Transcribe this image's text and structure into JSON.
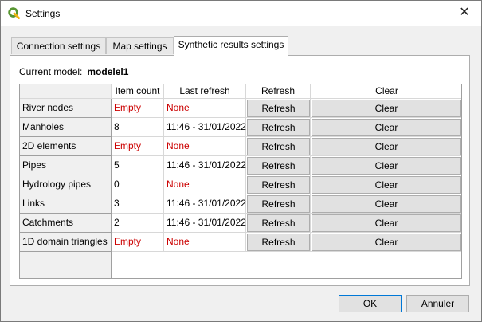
{
  "window": {
    "title": "Settings"
  },
  "tabs": [
    {
      "label": "Connection settings",
      "active": false
    },
    {
      "label": "Map settings",
      "active": false
    },
    {
      "label": "Synthetic results settings",
      "active": true
    }
  ],
  "model": {
    "label": "Current model:",
    "value": "modelel1"
  },
  "table": {
    "headers": [
      "Item count",
      "Last refresh",
      "Refresh",
      "Clear"
    ],
    "rows": [
      {
        "name": "River nodes",
        "count": "Empty",
        "last_refresh": "None",
        "refresh": "Refresh",
        "clear": "Clear",
        "empty": true
      },
      {
        "name": "Manholes",
        "count": "8",
        "last_refresh": "11:46 - 31/01/2022",
        "refresh": "Refresh",
        "clear": "Clear",
        "empty": false
      },
      {
        "name": "2D elements",
        "count": "Empty",
        "last_refresh": "None",
        "refresh": "Refresh",
        "clear": "Clear",
        "empty": true
      },
      {
        "name": "Pipes",
        "count": "5",
        "last_refresh": "11:46 - 31/01/2022",
        "refresh": "Refresh",
        "clear": "Clear",
        "empty": false
      },
      {
        "name": "Hydrology pipes",
        "count": "0",
        "last_refresh": "None",
        "refresh": "Refresh",
        "clear": "Clear",
        "empty": false,
        "last_refresh_red": true
      },
      {
        "name": "Links",
        "count": "3",
        "last_refresh": "11:46 - 31/01/2022",
        "refresh": "Refresh",
        "clear": "Clear",
        "empty": false
      },
      {
        "name": "Catchments",
        "count": "2",
        "last_refresh": "11:46 - 31/01/2022",
        "refresh": "Refresh",
        "clear": "Clear",
        "empty": false
      },
      {
        "name": "1D domain triangles",
        "count": "Empty",
        "last_refresh": "None",
        "refresh": "Refresh",
        "clear": "Clear",
        "empty": true
      }
    ]
  },
  "footer": {
    "ok_label": "OK",
    "cancel_label": "Annuler"
  },
  "colors": {
    "empty_text": "#cc0000",
    "qgis_green": "#589632",
    "qgis_yellow": "#f0b411"
  },
  "icons": {
    "app": "qgis-logo-icon",
    "close": "close-icon"
  }
}
